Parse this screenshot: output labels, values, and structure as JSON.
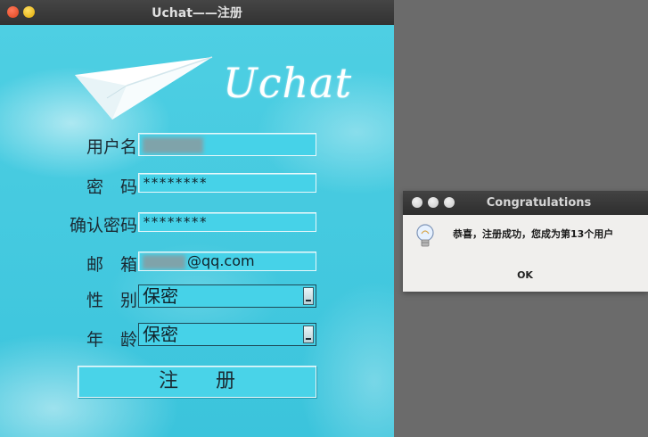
{
  "main_window": {
    "title": "Uchat——注册",
    "brand": "Uchat",
    "fields": {
      "username": {
        "label": "用户名",
        "value": ""
      },
      "password": {
        "label": "密　码",
        "value": "********"
      },
      "confirm_password": {
        "label": "确认密码",
        "value": "********"
      },
      "email": {
        "label": "邮　箱",
        "value": "@qq.com"
      },
      "gender": {
        "label": "性　别",
        "value": "保密"
      },
      "age": {
        "label": "年　龄",
        "value": "保密"
      }
    },
    "register_label": "注册",
    "colors": {
      "background": "#3fc5dc",
      "field": "#46d2e8"
    }
  },
  "dialog": {
    "title": "Congratulations",
    "message": "恭喜，注册成功，您成为第13个用户",
    "ok_label": "OK",
    "icon": "lightbulb-icon"
  }
}
